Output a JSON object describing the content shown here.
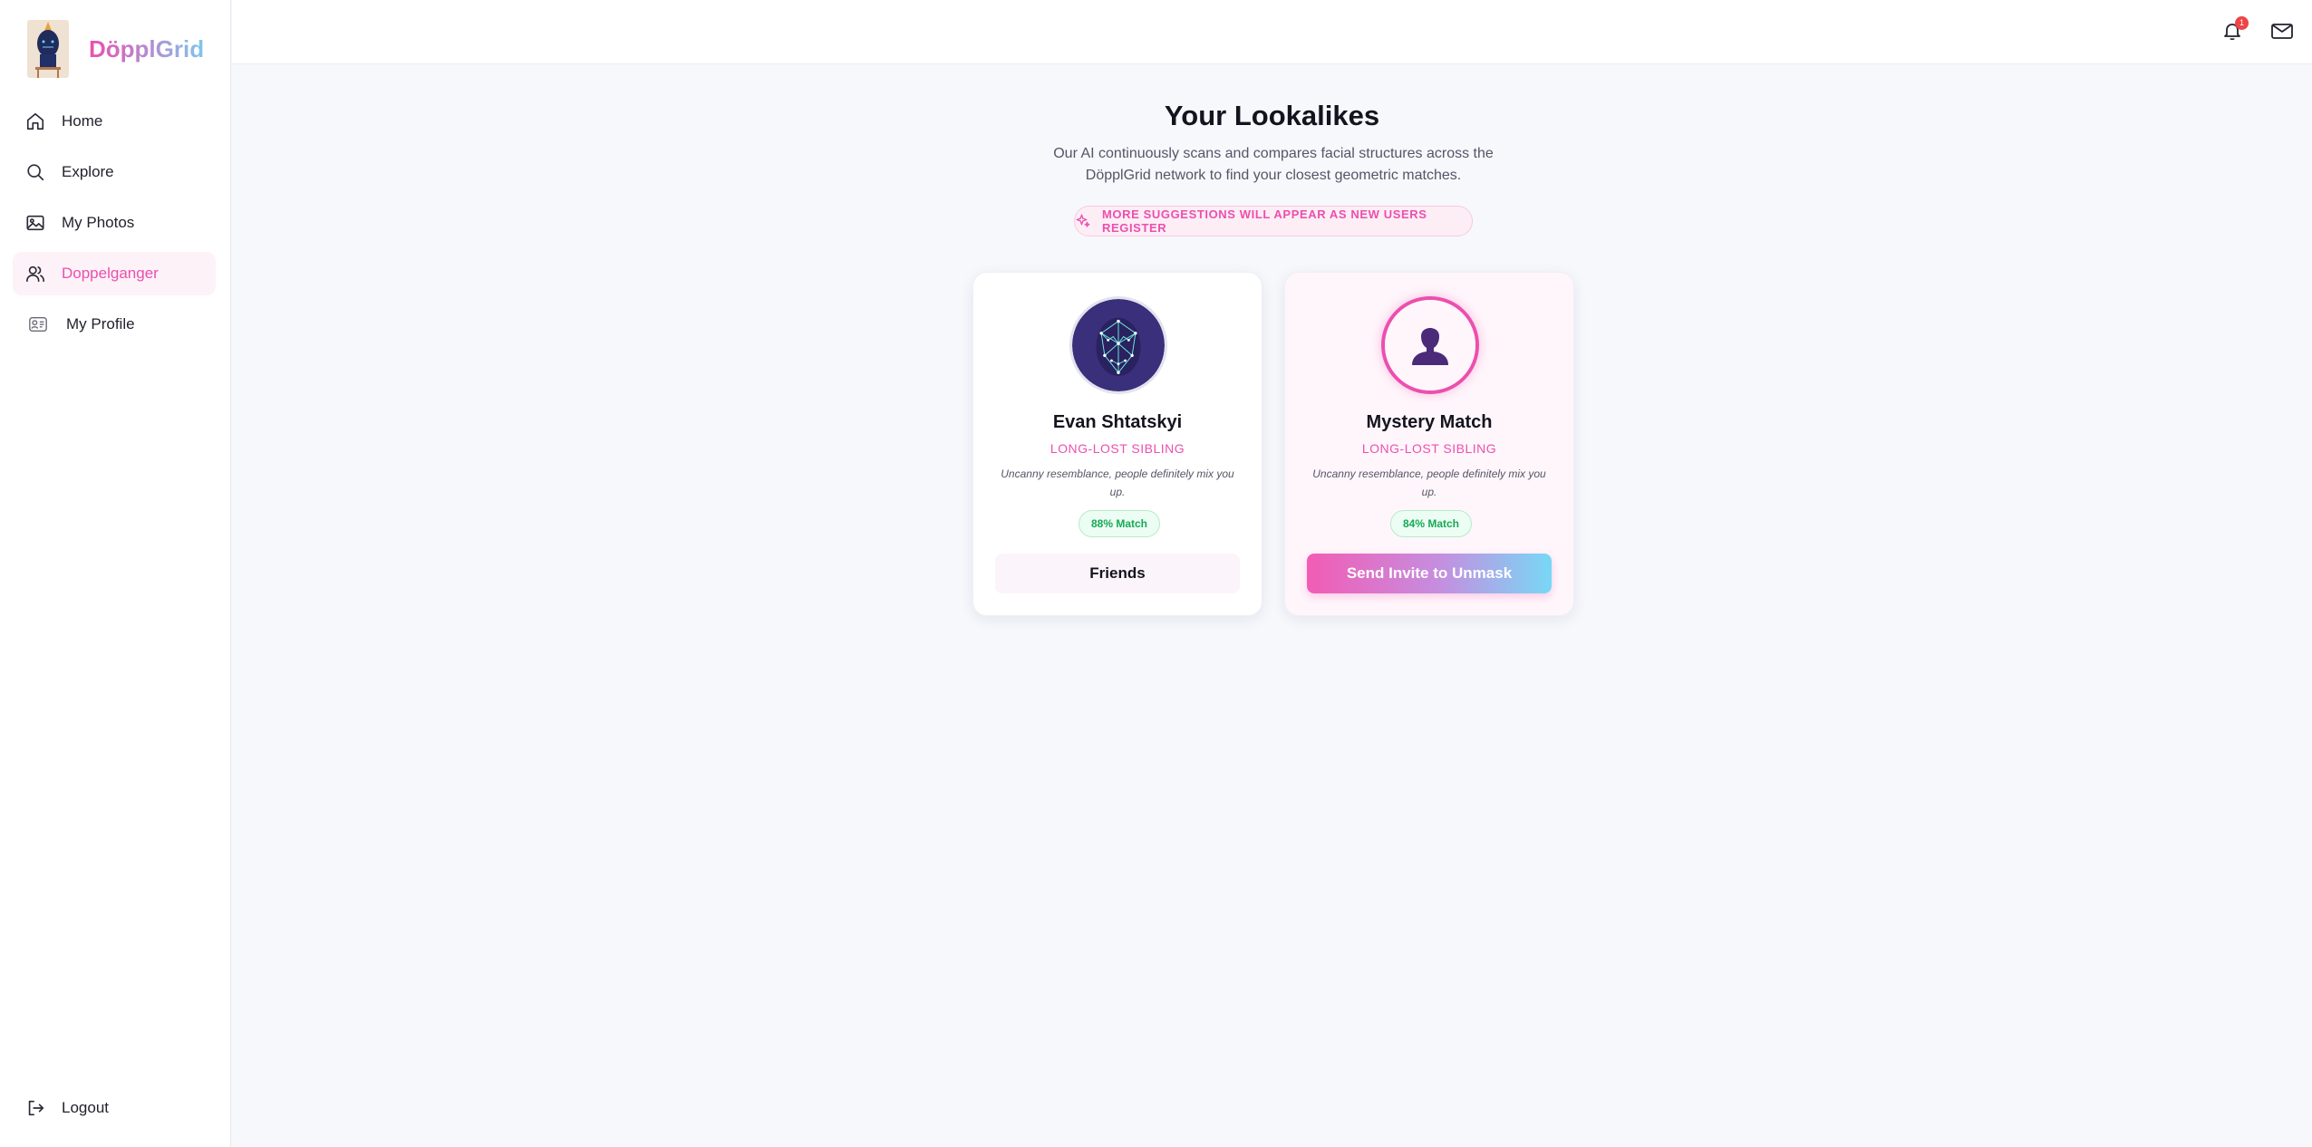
{
  "app": {
    "brand_name": "DöpplGrid"
  },
  "sidebar": {
    "items": [
      {
        "label": "Home",
        "icon": "home-icon"
      },
      {
        "label": "Explore",
        "icon": "search-icon"
      },
      {
        "label": "My Photos",
        "icon": "photos-icon"
      },
      {
        "label": "Doppelganger",
        "icon": "users-icon",
        "active": true
      },
      {
        "label": "My Profile",
        "icon": "profile-icon"
      }
    ],
    "logout_label": "Logout"
  },
  "topbar": {
    "notification_count": "1"
  },
  "main": {
    "title": "Your Lookalikes",
    "subtitle": "Our AI continuously scans and compares facial structures across the DöpplGrid network to find your closest geometric matches.",
    "notice": "MORE SUGGESTIONS WILL APPEAR AS NEW USERS REGISTER",
    "cards": [
      {
        "name": "Evan Shtatskyi",
        "tag": "LONG-LOST SIBLING",
        "description": "Uncanny resemblance, people definitely mix you up.",
        "match": "88% Match",
        "button": "Friends"
      },
      {
        "name": "Mystery Match",
        "tag": "LONG-LOST SIBLING",
        "description": "Uncanny resemblance, people definitely mix you up.",
        "match": "84% Match",
        "button": "Send Invite to Unmask"
      }
    ]
  },
  "colors": {
    "accent": "#ec4fae",
    "accent_secondary": "#7fc6ee",
    "match_green": "#18a957",
    "background": "#f6f8fc"
  }
}
